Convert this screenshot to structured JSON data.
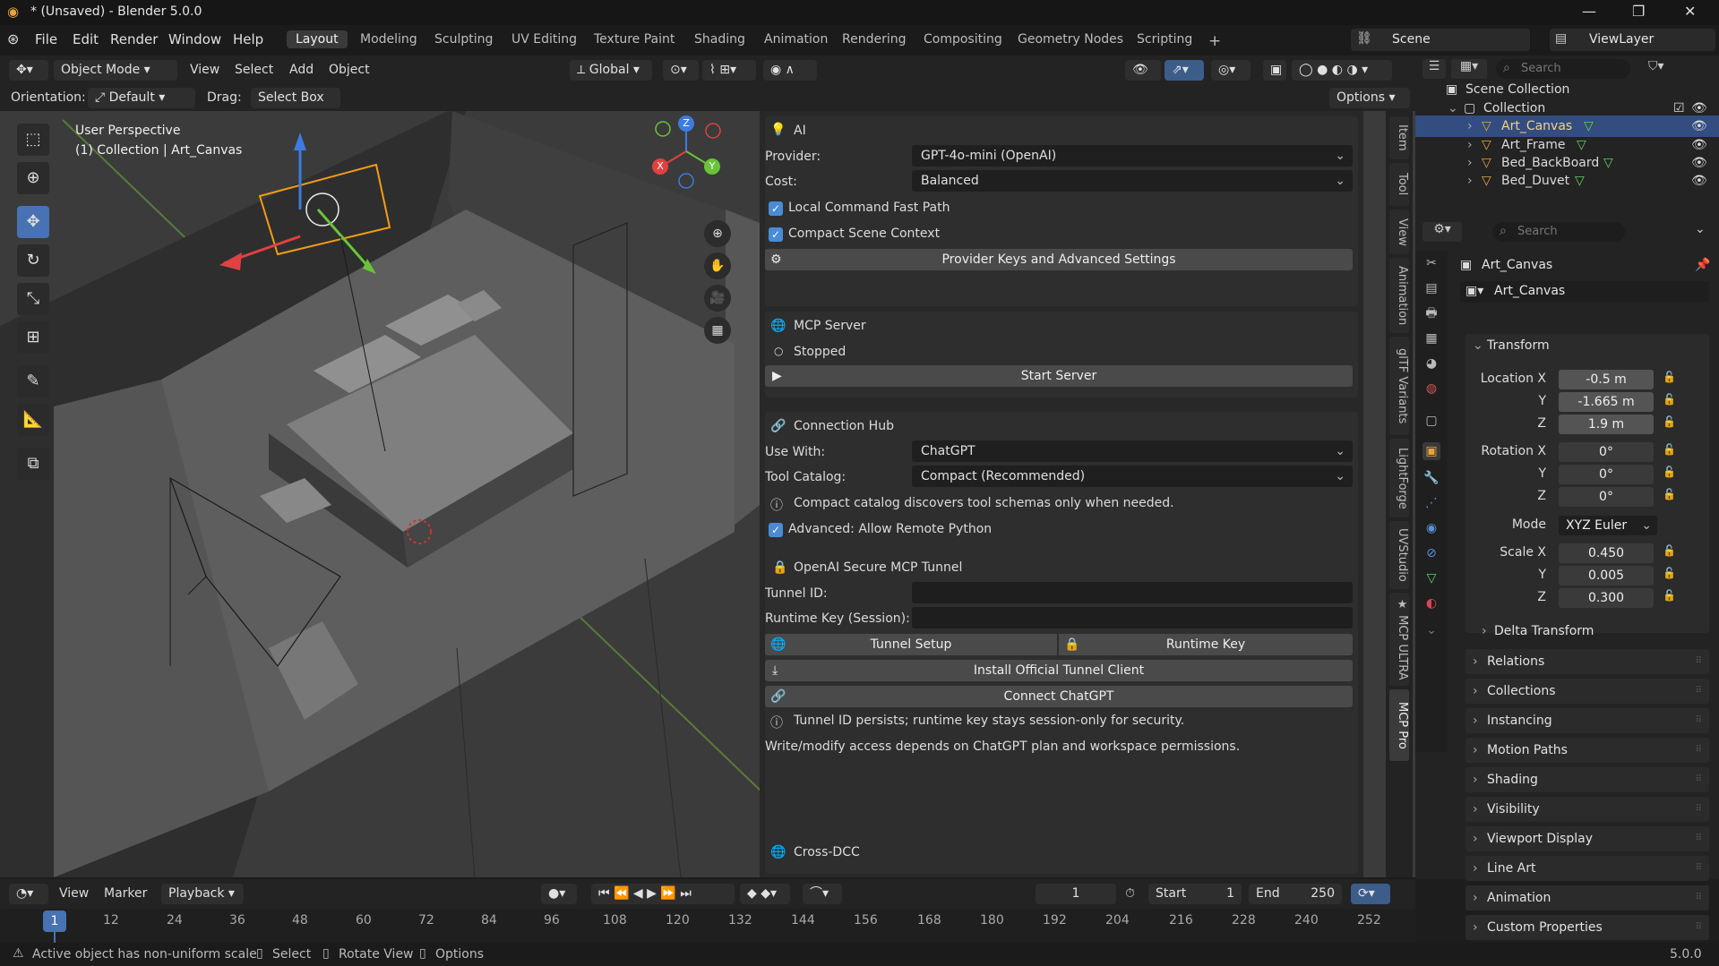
{
  "window": {
    "title": "* (Unsaved) - Blender 5.0.0",
    "min": "—",
    "max": "❐",
    "close": "✕"
  },
  "menu": [
    "File",
    "Edit",
    "Render",
    "Window",
    "Help"
  ],
  "workspaces": [
    "Layout",
    "Modeling",
    "Sculpting",
    "UV Editing",
    "Texture Paint",
    "Shading",
    "Animation",
    "Rendering",
    "Compositing",
    "Geometry Nodes",
    "Scripting"
  ],
  "active_workspace": "Layout",
  "scene": {
    "scene_name": "Scene",
    "view_layer": "ViewLayer"
  },
  "viewport_header": {
    "mode": "Object Mode",
    "menus": [
      "View",
      "Select",
      "Add",
      "Object"
    ],
    "transform_orientation": "Global",
    "orientation_label": "Orientation:",
    "orientation_value": "Default",
    "drag_label": "Drag:",
    "drag_value": "Select Box",
    "options_label": "Options"
  },
  "viewport": {
    "perspective": "User Perspective",
    "collection_info": "(1) Collection | Art_Canvas",
    "gizmo": {
      "x": "X",
      "y": "Y",
      "z": "Z"
    }
  },
  "npanel": {
    "ai": {
      "title": "AI",
      "provider_label": "Provider:",
      "provider_value": "GPT-4o-mini (OpenAI)",
      "cost_label": "Cost:",
      "cost_value": "Balanced",
      "local_fast_path": "Local Command Fast Path",
      "compact_context": "Compact Scene Context",
      "provider_keys_button": "Provider Keys and Advanced Settings"
    },
    "mcp": {
      "title": "MCP Server",
      "status": "Stopped",
      "start_button": "Start Server"
    },
    "hub": {
      "title": "Connection Hub",
      "use_with_label": "Use With:",
      "use_with_value": "ChatGPT",
      "catalog_label": "Tool Catalog:",
      "catalog_value": "Compact (Recommended)",
      "catalog_info": "Compact catalog discovers tool schemas only when needed.",
      "allow_python": "Advanced: Allow Remote Python",
      "tunnel_title": "OpenAI Secure MCP Tunnel",
      "tunnel_id_label": "Tunnel ID:",
      "tunnel_id_value": "",
      "runtime_key_label": "Runtime Key (Session):",
      "runtime_key_value": "",
      "tunnel_setup_button": "Tunnel Setup",
      "runtime_key_button": "Runtime Key",
      "install_button": "Install Official Tunnel Client",
      "connect_button": "Connect ChatGPT",
      "security_note": "Tunnel ID persists; runtime key stays session-only for security.",
      "access_note": "Write/modify access depends on ChatGPT plan and workspace permissions."
    },
    "cross_dcc": {
      "title": "Cross-DCC"
    },
    "tabs": [
      "Item",
      "Tool",
      "View",
      "Animation",
      "glTF Variants",
      "LightForge",
      "UVStudio",
      "★ MCP ULTRA",
      "MCP Pro"
    ]
  },
  "outliner": {
    "search_placeholder": "Search",
    "root": "Scene Collection",
    "collection": "Collection",
    "items": [
      "Art_Canvas",
      "Art_Frame",
      "Bed_BackBoard",
      "Bed_Duvet"
    ]
  },
  "properties": {
    "search_placeholder": "Search",
    "object_name": "Art_Canvas",
    "data_name": "Art_Canvas",
    "transform_title": "Transform",
    "location": {
      "label": "Location",
      "x": "-0.5 m",
      "y": "-1.665 m",
      "z": "1.9 m"
    },
    "rotation": {
      "label": "Rotation",
      "x": "0°",
      "y": "0°",
      "z": "0°"
    },
    "mode_label": "Mode",
    "mode_value": "XYZ Euler",
    "scale": {
      "label": "Scale",
      "x": "0.450",
      "y": "0.005",
      "z": "0.300"
    },
    "axis_x": "X",
    "axis_y": "Y",
    "axis_z": "Z",
    "delta_transform": "Delta Transform",
    "panels": [
      "Relations",
      "Collections",
      "Instancing",
      "Motion Paths",
      "Shading",
      "Visibility",
      "Viewport Display",
      "Line Art",
      "Animation",
      "Custom Properties"
    ]
  },
  "timeline": {
    "menus": [
      "View",
      "Marker",
      "Playback"
    ],
    "current_frame": "1",
    "start_label": "Start",
    "start_value": "1",
    "end_label": "End",
    "end_value": "250",
    "ticks": [
      "12",
      "24",
      "36",
      "48",
      "60",
      "72",
      "84",
      "96",
      "108",
      "120",
      "132",
      "144",
      "156",
      "168",
      "180",
      "192",
      "204",
      "216",
      "228",
      "240",
      "252"
    ],
    "playhead": "1"
  },
  "status": {
    "warning": "Active object has non-uniform scale",
    "select": "Select",
    "rotate": "Rotate View",
    "options": "Options",
    "version": "5.0.0"
  },
  "colors": {
    "accent": "#4772b3",
    "checkbox": "#4a8bd6",
    "selected_row": "#334d80",
    "object_orange": "#e8a33d"
  }
}
